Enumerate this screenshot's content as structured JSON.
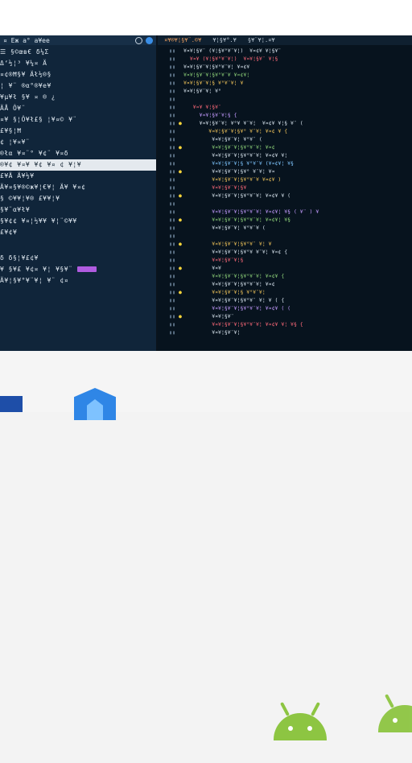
{
  "sidebar": {
    "header": "¤ Eж a° a¥ee",
    "rows": [
      "☰ §©œв€ δ¼Σ",
      "  Δ‘½¦³  ¥¼¤ Ä",
      "¤¢®Ħ§¥ Äł½®§",
      "  ¦   ¥¨   ®α°®¥е¥",
      "   ¥µ¥ł §¥ ¤ ® ¿",
      "              ÄÅ Ô¥¨",
      "¤¥ §¦Ô¥ł£§ ¦¥¤© ¥¨",
      "     £¥§¦Ħ",
      "    ¢ ¦¥¤¥¨",
      "®łα  ¥¤¨°  ¥¢¨ ¥¤δ",
      "£¥Ä  Ä¥½¥",
      "Ä¥¤§¥®©ж¥¦€¥¦ Ä¥ ¥¤¢",
      "§ ©¥¥¦¥®  £¥¥¦¥",
      "§¥¨α¥ł¥",
      "§¥¢¢    ¥¤¦½¥¥  ¥¦¨©¥¥",
      "£¥¢¥",
      "",
      "",
      "",
      "δ δ§¦¥£¢¥",
      "¥ §¥£  ¥¢¤ ¥¦ ¥§¥¨",
      "Ä¥¦§¥°¥¨¥¦ ¥¨ ¢¤"
    ],
    "selected_row": "®¥¢  ¥¤¥ ¥¢ ¥¤ ¢ ¥¦¥"
  },
  "editor": {
    "tabs": [
      "¤¥®¥¦§¥¨.©¥",
      "¥¦§¥°.¥",
      "§¥¨¥¦.¤¥"
    ],
    "lines": [
      {
        "t": "default",
        "s": "¥¤¥¦§¥¨ (¥¦§¥°¥¨¥¦)  ¥¤¢¥ ¥¦§¥¨"
      },
      {
        "t": "kw",
        "s": "  ¥¤¥ (¥¦§¥°¥¨¥¦)  ¥¤¥¦§¥¨ ¥¦§"
      },
      {
        "t": "default",
        "s": "¥¤¥¦§¥¨¥¦§¥°¥¨¥¦ ¥¤¢¥"
      },
      {
        "t": "str",
        "s": "¥¤¥¦§¥¨¥¦§¥°¥¨¥ ¥¤¢¥¦"
      },
      {
        "t": "fn",
        "s": "¥¤¥¦§¥¨¥¦§ ¥°¥¨¥¦ ¥"
      },
      {
        "t": "default",
        "s": "¥¤¥¦§¥¨¥¦ ¥°"
      },
      {
        "t": "default",
        "s": ""
      },
      {
        "t": "kw",
        "s": "   ¥¤¥ ¥¦§¥¨"
      },
      {
        "t": "type",
        "s": "     ¥¤¥¦§¥¨¥¦§ {"
      },
      {
        "t": "default",
        "s": "     ¥¤¥¦§¥¨¥¦ ¥°¥ ¥¨¥¦  ¥¤¢¥ ¥¦§ ¥¨ ("
      },
      {
        "t": "fn",
        "s": "        ¥¤¥¦§¥¨¥¦§¥° ¥¨¥¦ ¥¤¢ ¥ {"
      },
      {
        "t": "default",
        "s": "         ¥¤¥¦§¥¨¥¦ ¥°¥¨ ("
      },
      {
        "t": "str",
        "s": "         ¥¤¥¦§¥¨¥¦§¥°¥¨¥¦ ¥¤¢"
      },
      {
        "t": "default",
        "s": "         ¥¤¥¦§¥¨¥¦§¥°¥¨¥¦ ¥¤¢¥ ¥¦"
      },
      {
        "t": "num",
        "s": "         ¥¤¥¦§¥¨¥¦§ ¥°¥¨¥ (¥¤¢¥¦ ¥§"
      },
      {
        "t": "default",
        "s": "         ¥¤¥¦§¥¨¥¦§¥° ¥¨¥¦ ¥¤"
      },
      {
        "t": "fn",
        "s": "         ¥¤¥¦§¥¨¥¦§¥°¥¨¥ ¥¤¢¥ )"
      },
      {
        "t": "kw",
        "s": "         ¥¤¥¦§¥¨¥¦§¥"
      },
      {
        "t": "default",
        "s": "         ¥¤¥¦§¥¨¥¦§¥°¥¨¥¦ ¥¤¢¥ ¥ ("
      },
      {
        "t": "default",
        "s": ""
      },
      {
        "t": "type",
        "s": "         ¥¤¥¦§¥¨¥¦§¥°¥¨¥¦ ¥¤¢¥¦ ¥§ ( ¥¨ ) ¥"
      },
      {
        "t": "str",
        "s": "         ¥¤¥¦§¥¨¥¦§¥°¥¨¥¦ ¥¤¢¥¦ ¥§"
      },
      {
        "t": "default",
        "s": "         ¥¤¥¦§¥¨¥¦ ¥°¥¨¥ ("
      },
      {
        "t": "default",
        "s": ""
      },
      {
        "t": "fn",
        "s": "         ¥¤¥¦§¥¨¥¦§¥°¥¨ ¥¦ ¥"
      },
      {
        "t": "default",
        "s": "         ¥¤¥¦§¥¨¥¦§¥°¥ ¥¨¥¦ ¥¤¢ {"
      },
      {
        "t": "kw",
        "s": "         ¥¤¥¦§¥¨¥¦§"
      },
      {
        "t": "default",
        "s": "         ¥¤¥"
      },
      {
        "t": "str",
        "s": "         ¥¤¥¦§¥¨¥¦§¥°¥¨¥¦ ¥¤¢¥ {"
      },
      {
        "t": "default",
        "s": "         ¥¤¥¦§¥¨¥¦§¥°¥¨¥¦ ¥¤¢"
      },
      {
        "t": "fn",
        "s": "         ¥¤¥¦§¥¨¥¦§ ¥°¥¨¥¦"
      },
      {
        "t": "default",
        "s": "         ¥¤¥¦§¥¨¥¦§¥°¥¨ ¥¦ ¥ ( {"
      },
      {
        "t": "type",
        "s": "         ¥¤¥¦§¥¨¥¦§¥°¥¨¥¦ ¥¤¢¥ ( ("
      },
      {
        "t": "default",
        "s": "         ¥¤¥¦§¥¨"
      },
      {
        "t": "kw",
        "s": "         ¥¤¥¦§¥¨¥¦§¥°¥¨¥¦ ¥¤¢¥ ¥¦ ¥§ {"
      },
      {
        "t": "default",
        "s": "         ¥¤¥¦§¥¨¥¦"
      }
    ]
  },
  "dock": {
    "icons": [
      "windows-tile-icon",
      "hexagon-app-icon",
      "android-icon",
      "android-icon"
    ]
  }
}
